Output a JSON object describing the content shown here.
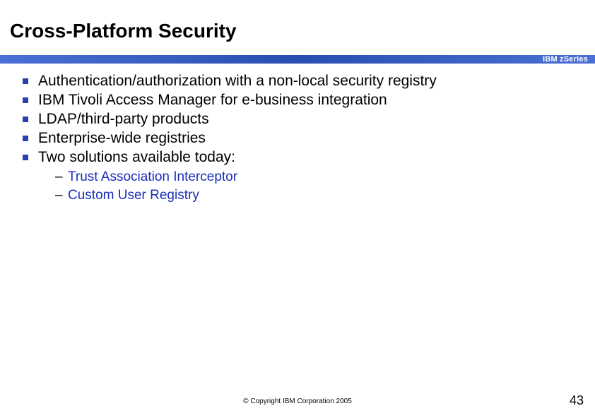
{
  "title": "Cross-Platform Security",
  "brand": "IBM zSeries",
  "bullets": [
    "Authentication/authorization with a non-local security registry",
    "IBM Tivoli Access Manager for e-business integration",
    "LDAP/third-party products",
    "Enterprise-wide registries",
    "Two solutions available today:"
  ],
  "subitems": [
    "Trust Association Interceptor",
    "Custom User Registry"
  ],
  "footer": "© Copyright IBM Corporation 2005",
  "page_number": "43"
}
